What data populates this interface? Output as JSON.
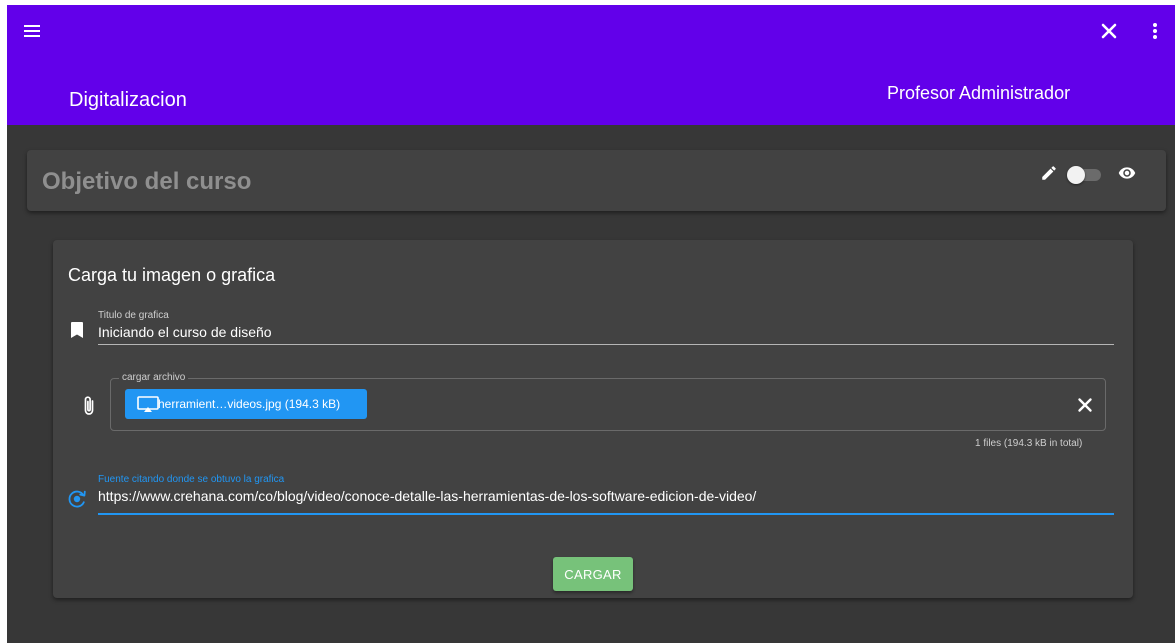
{
  "header": {
    "app_title": "Digitalizacion",
    "user_name": "Profesor Administrador",
    "color": "#6200ea"
  },
  "objective_card": {
    "title": "Objetivo del curso",
    "visibility_toggle_on": false
  },
  "upload_form": {
    "heading": "Carga tu imagen o grafica",
    "title_field": {
      "label": "Titulo de grafica",
      "value": "Iniciando el curso de diseño",
      "icon": "bookmark-icon"
    },
    "file_field": {
      "label": "cargar archivo",
      "chip_label": "herramient…videos.jpg (194.3 kB)",
      "summary": "1 files (194.3 kB in total)",
      "icon": "paperclip-icon"
    },
    "source_field": {
      "label": "Fuente citando donde se obtuvo la grafica",
      "value": "https://www.crehana.com/co/blog/video/conoce-detalle-las-herramientas-de-los-software-edicion-de-video/",
      "icon": "source-icon",
      "accent_color": "#2196f3"
    },
    "submit_label": "CARGAR",
    "submit_color": "#77c27a"
  }
}
